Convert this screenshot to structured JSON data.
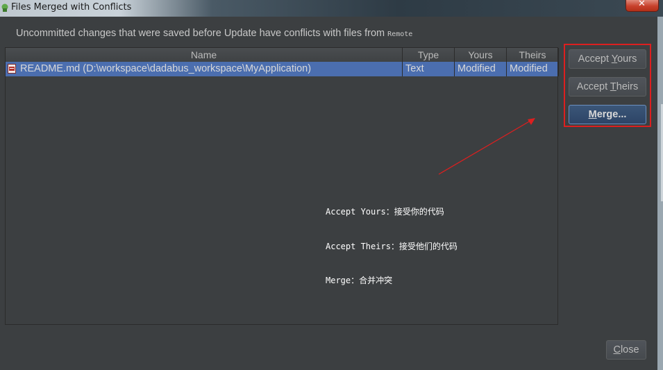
{
  "window": {
    "title": "Files Merged with Conflicts",
    "close_glyph": "✕"
  },
  "message": {
    "text": "Uncommitted changes that were saved before Update have conflicts with files from ",
    "source": "Remote"
  },
  "table": {
    "columns": [
      "Name",
      "Type",
      "Yours",
      "Theirs"
    ],
    "rows": [
      {
        "name": "README.md (D:\\workspace\\dadabus_workspace\\MyApplication)",
        "type": "Text",
        "yours": "Modified",
        "theirs": "Modified",
        "icon": "markdown-file-icon"
      }
    ]
  },
  "buttons": {
    "accept_yours_prefix": "Accept ",
    "accept_yours_mnemonic": "Y",
    "accept_yours_rest": "ours",
    "accept_theirs_prefix": "Accept ",
    "accept_theirs_mnemonic": "T",
    "accept_theirs_rest": "heirs",
    "merge_mnemonic": "M",
    "merge_rest": "erge...",
    "close_mnemonic": "C",
    "close_rest": "lose"
  },
  "annotation": {
    "line1": "Accept Yours：接受你的代码",
    "line2": "Accept Theirs：接受他们的代码",
    "line3": "Merge：合并冲突"
  },
  "colors": {
    "background": "#3c3f41",
    "selection": "#4b6eaf",
    "highlight_red": "#dd1f1f",
    "primary_button": "#2d4466"
  }
}
